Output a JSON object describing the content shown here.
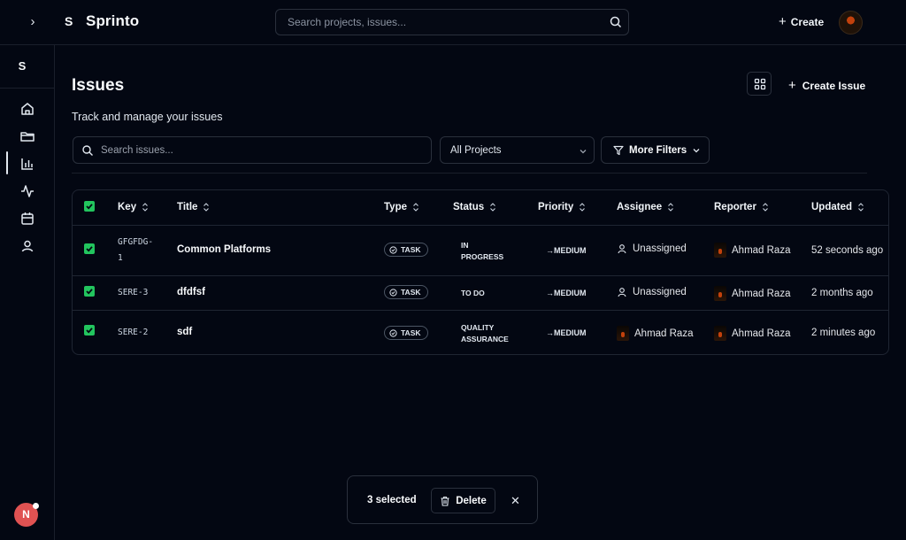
{
  "topbar": {
    "brand_letter": "S",
    "brand_name": "Sprinto",
    "search_placeholder": "Search projects, issues...",
    "create_label": "Create"
  },
  "sidebar": {
    "logo_letter": "S",
    "items": [
      {
        "icon": "home-icon"
      },
      {
        "icon": "folder-icon"
      },
      {
        "icon": "bar-chart-icon"
      },
      {
        "icon": "activity-icon"
      },
      {
        "icon": "calendar-icon"
      },
      {
        "icon": "user-icon"
      }
    ],
    "user_initial": "N"
  },
  "page": {
    "title": "Issues",
    "subtitle": "Track and manage your issues",
    "create_issue_label": "Create Issue"
  },
  "filters": {
    "search_placeholder": "Search issues...",
    "project_select": "All Projects",
    "more_filters": "More Filters"
  },
  "table": {
    "headers": [
      "Key",
      "Title",
      "Type",
      "Status",
      "Priority",
      "Assignee",
      "Reporter",
      "Updated"
    ],
    "rows": [
      {
        "key_line1": "GFGFDG-",
        "key_line2": "1",
        "title": "Common Platforms",
        "type": "TASK",
        "status_line1": "IN",
        "status_line2": "PROGRESS",
        "priority": "→MEDIUM",
        "assignee": "Unassigned",
        "reporter": "Ahmad Raza",
        "updated": "52 seconds ago",
        "checked": true
      },
      {
        "key_line1": "SERE-3",
        "key_line2": "",
        "title": "dfdfsf",
        "type": "TASK",
        "status_line1": "TO DO",
        "status_line2": "",
        "priority": "→MEDIUM",
        "assignee": "Unassigned",
        "reporter": "Ahmad Raza",
        "updated": "2 months ago",
        "checked": true
      },
      {
        "key_line1": "SERE-2",
        "key_line2": "",
        "title": "sdf",
        "type": "TASK",
        "status_line1": "QUALITY",
        "status_line2": "ASSURANCE",
        "priority": "→MEDIUM",
        "assignee": "Ahmad Raza",
        "reporter": "Ahmad Raza",
        "updated": "2 minutes ago",
        "checked": true
      }
    ]
  },
  "bulk": {
    "count_label": "3 selected",
    "delete_label": "Delete"
  },
  "colors": {
    "background": "#030712",
    "checkbox": "#22c55e",
    "avatar_n": "#e05252"
  }
}
